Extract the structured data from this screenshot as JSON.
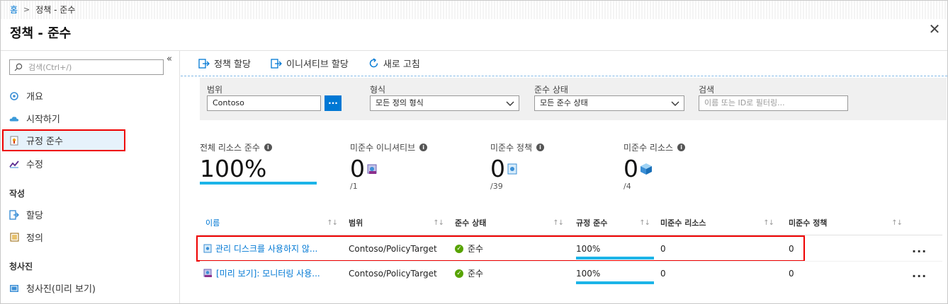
{
  "breadcrumb": {
    "home": "홈",
    "separator": ">",
    "current": "정책 - 준수"
  },
  "page": {
    "title": "정책 - 준수",
    "close_label": "✕"
  },
  "sidebar": {
    "collapse_label": "«",
    "search_placeholder": "검색(Ctrl+/)",
    "items": [
      {
        "label": "개요",
        "icon": "overview-icon"
      },
      {
        "label": "시작하기",
        "icon": "cloud-icon"
      },
      {
        "label": "규정 준수",
        "icon": "compliance-icon"
      },
      {
        "label": "수정",
        "icon": "remediation-icon"
      }
    ],
    "sections": [
      {
        "title": "작성",
        "items": [
          {
            "label": "할당",
            "icon": "assign-icon"
          },
          {
            "label": "정의",
            "icon": "definition-icon"
          }
        ]
      },
      {
        "title": "청사진",
        "items": [
          {
            "label": "청사진(미리 보기)",
            "icon": "blueprint-icon"
          }
        ]
      }
    ]
  },
  "toolbar": {
    "assign_policy": "정책 할당",
    "assign_initiative": "이니셔티브 할당",
    "refresh": "새로 고침"
  },
  "filters": {
    "scope_label": "범위",
    "scope_value": "Contoso",
    "scope_button": "...",
    "type_label": "형식",
    "type_value": "모든 정의 형식",
    "status_label": "준수 상태",
    "status_value": "모든 준수 상태",
    "search_label": "검색",
    "search_placeholder": "이름 또는 ID로 필터링..."
  },
  "stats": {
    "overall": {
      "label": "전체 리소스 준수",
      "value": "100%",
      "progress": 100
    },
    "initiatives": {
      "label": "미준수 이니셔티브",
      "value": "0",
      "sub": "/1"
    },
    "policies": {
      "label": "미준수 정책",
      "value": "0",
      "sub": "/39"
    },
    "resources": {
      "label": "미준수 리소스",
      "value": "0",
      "sub": "/4"
    }
  },
  "table": {
    "columns": [
      "이름",
      "범위",
      "준수 상태",
      "규정 준수",
      "미준수 리소스",
      "미준수 정책"
    ],
    "rows": [
      {
        "name": "관리 디스크를 사용하지 않...",
        "scope": "Contoso/PolicyTarget",
        "status": "준수",
        "compliance": "100%",
        "progress": 100,
        "noncompliant_resources": "0",
        "noncompliant_policies": "0",
        "more": "..."
      },
      {
        "name": "[미리 보기]: 모니터링 사용...",
        "scope": "Contoso/PolicyTarget",
        "status": "준수",
        "compliance": "100%",
        "progress": 100,
        "noncompliant_resources": "0",
        "noncompliant_policies": "0",
        "more": "..."
      }
    ]
  },
  "colors": {
    "accent": "#0078d4",
    "progress": "#1cb4e8",
    "ok": "#57a300",
    "highlight": "#ee0000"
  }
}
